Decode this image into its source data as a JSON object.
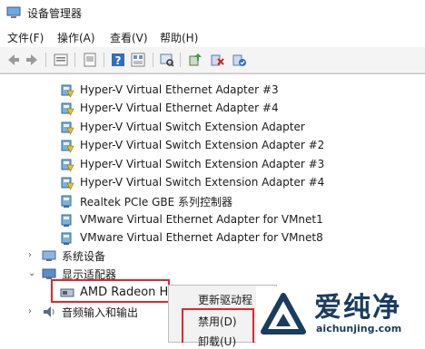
{
  "window": {
    "title": "设备管理器"
  },
  "menu": [
    {
      "label": "文件(F)"
    },
    {
      "label": "操作(A)"
    },
    {
      "label": "查看(V)"
    },
    {
      "label": "帮助(H)"
    }
  ],
  "toolbar": {
    "icons": [
      "back-arrow-icon",
      "forward-arrow-icon",
      "properties-icon",
      "show-hidden-icon",
      "help-icon",
      "view-icon",
      "scan-hardware-icon",
      "update-driver-icon",
      "uninstall-icon",
      "enable-device-icon"
    ]
  },
  "tree": {
    "network_items": [
      "Hyper-V Virtual Ethernet Adapter #3",
      "Hyper-V Virtual Ethernet Adapter #4",
      "Hyper-V Virtual Switch Extension Adapter",
      "Hyper-V Virtual Switch Extension Adapter #2",
      "Hyper-V Virtual Switch Extension Adapter #3",
      "Hyper-V Virtual Switch Extension Adapter #4",
      "Realtek PCIe GBE 系列控制器",
      "VMware Virtual Ethernet Adapter for VMnet1",
      "VMware Virtual Ethernet Adapter for VMnet8"
    ],
    "system_devices": "系统设备",
    "display_adapters": "显示适配器",
    "amd_device": "AMD Radeon HI",
    "audio": "音频输入和输出"
  },
  "context_menu": {
    "update_driver": "更新驱动程",
    "disable": "禁用(D)",
    "uninstall": "卸载(U)"
  },
  "watermark": {
    "text": "爱纯净",
    "url": "aichunjing.com"
  },
  "colors": {
    "highlight_red": "#e0262e",
    "watermark_blue": "#1a3c5e"
  }
}
